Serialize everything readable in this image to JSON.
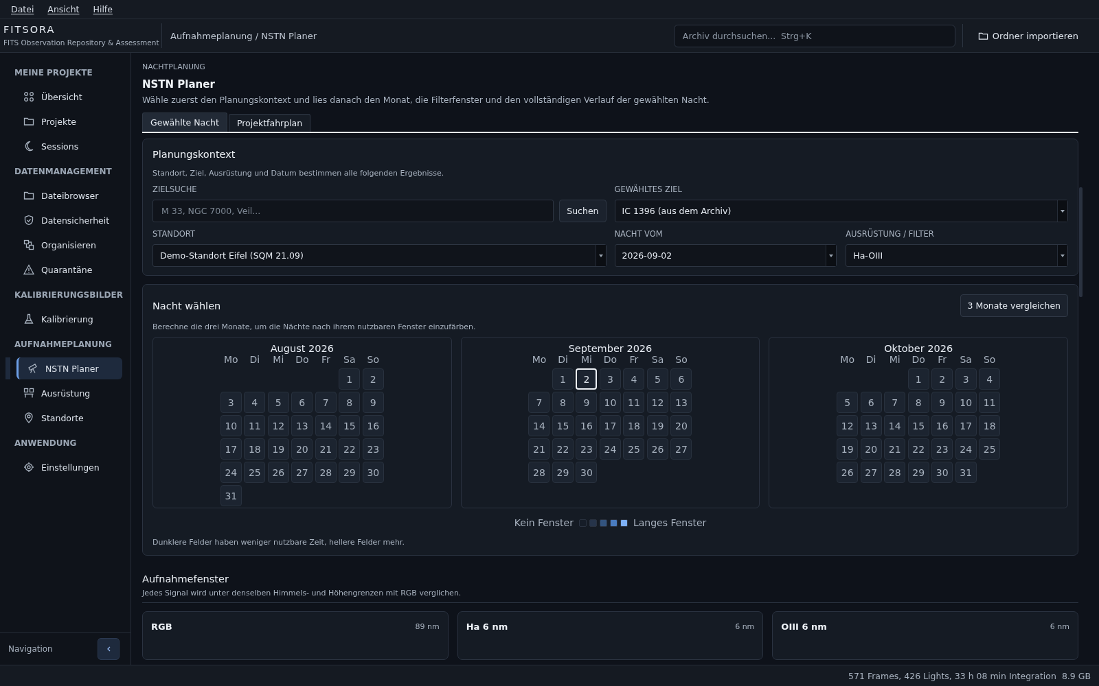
{
  "menu": [
    "Datei",
    "Ansicht",
    "Hilfe"
  ],
  "header": {
    "logo": "FITSORA",
    "subtitle": "FITS Observation Repository & Assessment",
    "breadcrumb": "Aufnahmeplanung / NSTN Planer",
    "search": {
      "placeholder": "Archiv durchsuchen...  Strg+K"
    },
    "import_button": "Ordner importieren"
  },
  "sidebar": {
    "sections": [
      {
        "title": "MEINE PROJEKTE",
        "items": [
          {
            "label": "Übersicht",
            "selected": false
          },
          {
            "label": "Projekte",
            "selected": false
          },
          {
            "label": "Sessions",
            "selected": false
          }
        ]
      },
      {
        "title": "DATENMANAGEMENT",
        "items": [
          {
            "label": "Dateibrowser",
            "selected": false
          },
          {
            "label": "Datensicherheit",
            "selected": false
          },
          {
            "label": "Organisieren",
            "selected": false
          },
          {
            "label": "Quarantäne",
            "selected": false
          }
        ]
      },
      {
        "title": "KALIBRIERUNGSBILDER",
        "items": [
          {
            "label": "Kalibrierung",
            "selected": false
          }
        ]
      },
      {
        "title": "AUFNAHMEPLANUNG",
        "items": [
          {
            "label": "NSTN Planer",
            "selected": true
          },
          {
            "label": "Ausrüstung",
            "selected": false
          },
          {
            "label": "Standorte",
            "selected": false
          }
        ]
      },
      {
        "title": "ANWENDUNG",
        "items": [
          {
            "label": "Einstellungen",
            "selected": false
          }
        ]
      }
    ],
    "footer": "Navigation"
  },
  "page": {
    "eyebrow": "NACHTPLANUNG",
    "title": "NSTN Planer",
    "intro": "Wähle zuerst den Planungskontext und lies danach den Monat, die Filterfenster und den vollständigen Verlauf der gewählten Nacht."
  },
  "tabs": [
    {
      "label": "Gewählte Nacht",
      "selected": true
    },
    {
      "label": "Projektfahrplan",
      "selected": false
    }
  ],
  "context": {
    "title": "Planungskontext",
    "hint": "Standort, Ziel, Ausrüstung und Datum bestimmen alle folgenden Ergebnisse.",
    "target_search": {
      "label": "ZIELSUCHE",
      "placeholder": "M 33, NGC 7000, Veil...",
      "button": "Suchen"
    },
    "selected_target": {
      "label": "GEWÄHLTES ZIEL",
      "value": "IC 1396  (aus dem Archiv)"
    },
    "location": {
      "label": "STANDORT",
      "value": "Demo-Standort Eifel  (SQM 21.09)"
    },
    "night": {
      "label": "NACHT VOM",
      "value": "2026-09-02"
    },
    "equipment": {
      "label": "AUSRÜSTUNG / FILTER",
      "value": "Ha-OIII"
    }
  },
  "night_picker": {
    "title": "Nacht wählen",
    "button": "3 Monate vergleichen",
    "hint": "Berechne die drei Monate, um die Nächte nach ihrem nutzbaren Fenster einzufärben.",
    "months": [
      {
        "title": "August 2026",
        "weekdays": [
          "Mo",
          "Di",
          "Mi",
          "Do",
          "Fr",
          "Sa",
          "So"
        ],
        "days": [
          {
            "kind": "blank"
          },
          {
            "kind": "blank"
          },
          {
            "kind": "blank"
          },
          {
            "kind": "blank"
          },
          {
            "kind": "blank"
          },
          {
            "label": "1",
            "selected": false
          },
          {
            "label": "2",
            "selected": false
          },
          {
            "label": "3",
            "selected": false
          },
          {
            "label": "4",
            "selected": false
          },
          {
            "label": "5",
            "selected": false
          },
          {
            "label": "6",
            "selected": false
          },
          {
            "label": "7",
            "selected": false
          },
          {
            "label": "8",
            "selected": false
          },
          {
            "label": "9",
            "selected": false
          },
          {
            "label": "10",
            "selected": false
          },
          {
            "label": "11",
            "selected": false
          },
          {
            "label": "12",
            "selected": false
          },
          {
            "label": "13",
            "selected": false
          },
          {
            "label": "14",
            "selected": false
          },
          {
            "label": "15",
            "selected": false
          },
          {
            "label": "16",
            "selected": false
          },
          {
            "label": "17",
            "selected": false
          },
          {
            "label": "18",
            "selected": false
          },
          {
            "label": "19",
            "selected": false
          },
          {
            "label": "20",
            "selected": false
          },
          {
            "label": "21",
            "selected": false
          },
          {
            "label": "22",
            "selected": false
          },
          {
            "label": "23",
            "selected": false
          },
          {
            "label": "24",
            "selected": false
          },
          {
            "label": "25",
            "selected": false
          },
          {
            "label": "26",
            "selected": false
          },
          {
            "label": "27",
            "selected": false
          },
          {
            "label": "28",
            "selected": false
          },
          {
            "label": "29",
            "selected": false
          },
          {
            "label": "30",
            "selected": false
          },
          {
            "label": "31",
            "selected": false
          }
        ]
      },
      {
        "title": "September 2026",
        "weekdays": [
          "Mo",
          "Di",
          "Mi",
          "Do",
          "Fr",
          "Sa",
          "So"
        ],
        "days": [
          {
            "kind": "blank"
          },
          {
            "label": "1",
            "selected": false
          },
          {
            "label": "2",
            "selected": true
          },
          {
            "label": "3",
            "selected": false
          },
          {
            "label": "4",
            "selected": false
          },
          {
            "label": "5",
            "selected": false
          },
          {
            "label": "6",
            "selected": false
          },
          {
            "label": "7",
            "selected": false
          },
          {
            "label": "8",
            "selected": false
          },
          {
            "label": "9",
            "selected": false
          },
          {
            "label": "10",
            "selected": false
          },
          {
            "label": "11",
            "selected": false
          },
          {
            "label": "12",
            "selected": false
          },
          {
            "label": "13",
            "selected": false
          },
          {
            "label": "14",
            "selected": false
          },
          {
            "label": "15",
            "selected": false
          },
          {
            "label": "16",
            "selected": false
          },
          {
            "label": "17",
            "selected": false
          },
          {
            "label": "18",
            "selected": false
          },
          {
            "label": "19",
            "selected": false
          },
          {
            "label": "20",
            "selected": false
          },
          {
            "label": "21",
            "selected": false
          },
          {
            "label": "22",
            "selected": false
          },
          {
            "label": "23",
            "selected": false
          },
          {
            "label": "24",
            "selected": false
          },
          {
            "label": "25",
            "selected": false
          },
          {
            "label": "26",
            "selected": false
          },
          {
            "label": "27",
            "selected": false
          },
          {
            "label": "28",
            "selected": false
          },
          {
            "label": "29",
            "selected": false
          },
          {
            "label": "30",
            "selected": false
          }
        ]
      },
      {
        "title": "Oktober 2026",
        "weekdays": [
          "Mo",
          "Di",
          "Mi",
          "Do",
          "Fr",
          "Sa",
          "So"
        ],
        "days": [
          {
            "kind": "blank"
          },
          {
            "kind": "blank"
          },
          {
            "kind": "blank"
          },
          {
            "label": "1",
            "selected": false
          },
          {
            "label": "2",
            "selected": false
          },
          {
            "label": "3",
            "selected": false
          },
          {
            "label": "4",
            "selected": false
          },
          {
            "label": "5",
            "selected": false
          },
          {
            "label": "6",
            "selected": false
          },
          {
            "label": "7",
            "selected": false
          },
          {
            "label": "8",
            "selected": false
          },
          {
            "label": "9",
            "selected": false
          },
          {
            "label": "10",
            "selected": false
          },
          {
            "label": "11",
            "selected": false
          },
          {
            "label": "12",
            "selected": false
          },
          {
            "label": "13",
            "selected": false
          },
          {
            "label": "14",
            "selected": false
          },
          {
            "label": "15",
            "selected": false
          },
          {
            "label": "16",
            "selected": false
          },
          {
            "label": "17",
            "selected": false
          },
          {
            "label": "18",
            "selected": false
          },
          {
            "label": "19",
            "selected": false
          },
          {
            "label": "20",
            "selected": false
          },
          {
            "label": "21",
            "selected": false
          },
          {
            "label": "22",
            "selected": false
          },
          {
            "label": "23",
            "selected": false
          },
          {
            "label": "24",
            "selected": false
          },
          {
            "label": "25",
            "selected": false
          },
          {
            "label": "26",
            "selected": false
          },
          {
            "label": "27",
            "selected": false
          },
          {
            "label": "28",
            "selected": false
          },
          {
            "label": "29",
            "selected": false
          },
          {
            "label": "30",
            "selected": false
          },
          {
            "label": "31",
            "selected": false
          }
        ]
      }
    ],
    "legend": {
      "start": "Kein Fenster",
      "end": "Langes Fenster",
      "swatches": [
        {
          "color": "#161d28"
        },
        {
          "color": "#26344a"
        },
        {
          "color": "#33547f"
        },
        {
          "color": "#4a7cc0"
        },
        {
          "color": "#7eb0f5"
        }
      ]
    },
    "footnote": "Dunklere Felder haben weniger nutzbare Zeit, hellere Felder mehr."
  },
  "windows": {
    "title": "Aufnahmefenster",
    "hint": "Jedes Signal wird unter denselben Himmels- und Höhengrenzen mit RGB verglichen.",
    "cards": [
      {
        "name": "RGB",
        "bandwidth": "89 nm"
      },
      {
        "name": "Ha 6 nm",
        "bandwidth": "6 nm"
      },
      {
        "name": "OIII 6 nm",
        "bandwidth": "6 nm"
      }
    ]
  },
  "status_bar": {
    "summary": "571 Frames, 426 Lights, 33 h 08 min Integration",
    "size": "8.9 GB"
  }
}
